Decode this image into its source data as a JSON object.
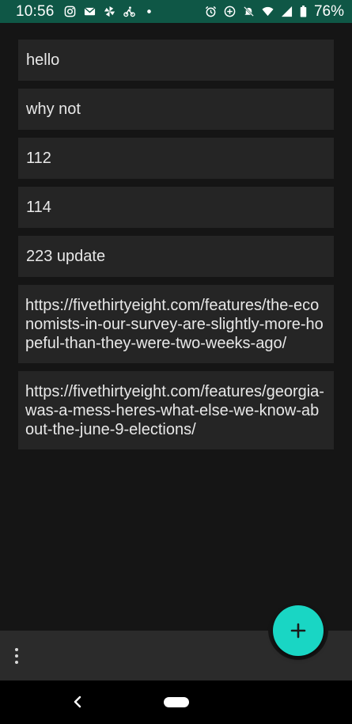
{
  "status_bar": {
    "time": "10:56",
    "battery": "76%",
    "left_icons": [
      "instagram-icon",
      "mail-icon",
      "pinwheel-icon",
      "bike-icon",
      "dot-icon"
    ],
    "right_icons": [
      "alarm-icon",
      "sync-icon",
      "mute-icon",
      "wifi-icon",
      "signal-icon",
      "battery-icon"
    ]
  },
  "notes": [
    {
      "text": "hello"
    },
    {
      "text": "why not"
    },
    {
      "text": "112"
    },
    {
      "text": "114"
    },
    {
      "text": "223 update"
    },
    {
      "text": "https://fivethirtyeight.com/features/the-economists-in-our-survey-are-slightly-more-hopeful-than-they-were-two-weeks-ago/"
    },
    {
      "text": "https://fivethirtyeight.com/features/georgia-was-a-mess-heres-what-else-we-know-about-the-june-9-elections/"
    }
  ],
  "fab": {
    "icon": "plus-icon",
    "color": "#19d6c4"
  },
  "bottom_bar": {
    "menu_icon": "more-vert-icon"
  },
  "nav": {
    "back_icon": "back-chevron-icon",
    "home_icon": "home-pill-icon"
  },
  "colors": {
    "background": "#151515",
    "card": "#252525",
    "status_bar": "#0f5746",
    "accent": "#19d6c4"
  }
}
